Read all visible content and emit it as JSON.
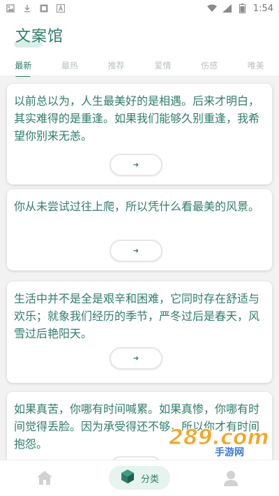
{
  "status": {
    "time": "1:54"
  },
  "app": {
    "title": "文案馆",
    "tabs": [
      {
        "label": "最新",
        "active": true
      },
      {
        "label": "最热",
        "active": false
      },
      {
        "label": "推荐",
        "active": false
      },
      {
        "label": "爱情",
        "active": false
      },
      {
        "label": "伤感",
        "active": false
      },
      {
        "label": "唯美",
        "active": false
      }
    ]
  },
  "cards": [
    {
      "text": "以前总以为，人生最美好的是相遇。后来才明白，其实难得的是重逢。如果我们能够久别重逢，我希望你别来无恙。"
    },
    {
      "text": "你从未尝试过往上爬，所以凭什么看最美的风景。"
    },
    {
      "text": "生活中并不是全是艰辛和困难，它同时存在舒适与欢乐；就象我们经历的季节，严冬过后是春天，风雪过后艳阳天。"
    },
    {
      "text": "如果真苦，你哪有时间喊累。如果真惨，你哪有时间觉得丢脸。因为承受得还不够，所以你才有时间抱怨。"
    }
  ],
  "bottomnav": {
    "center_label": "分类"
  },
  "colors": {
    "accent": "#2e7d6b",
    "tab_inactive": "#b9c3c0",
    "pill_bg": "#e6f3ee"
  },
  "watermark": {
    "text": "289.com",
    "sub": "手游网"
  }
}
